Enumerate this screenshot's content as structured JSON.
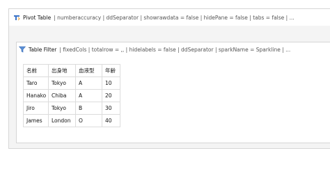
{
  "pivot": {
    "icon": "pivot-table-icon",
    "title": "Pivot Table",
    "params": "| numberaccuracy | ddSeparator | showrawdata = false | hidePane = false | tabs = false | ..."
  },
  "filter": {
    "icon": "filter-icon",
    "title": "Table Filter",
    "params": "| fixedCols | totalrow = ,, | hidelabels = false | ddSeparator | sparkName = Sparkline | ..."
  },
  "table": {
    "headers": [
      "名前",
      "出身地",
      "血液型",
      "年齢"
    ],
    "rows": [
      [
        "Taro",
        "Tokyo",
        "A",
        "10"
      ],
      [
        "Hanako",
        "Chiba",
        "A",
        "20"
      ],
      [
        "Jiro",
        "Tokyo",
        "B",
        "30"
      ],
      [
        "James",
        "London",
        "O",
        "40"
      ]
    ]
  },
  "colors": {
    "pivot_icon": "#3b73c7",
    "filter_icon": "#5a8fd6"
  }
}
